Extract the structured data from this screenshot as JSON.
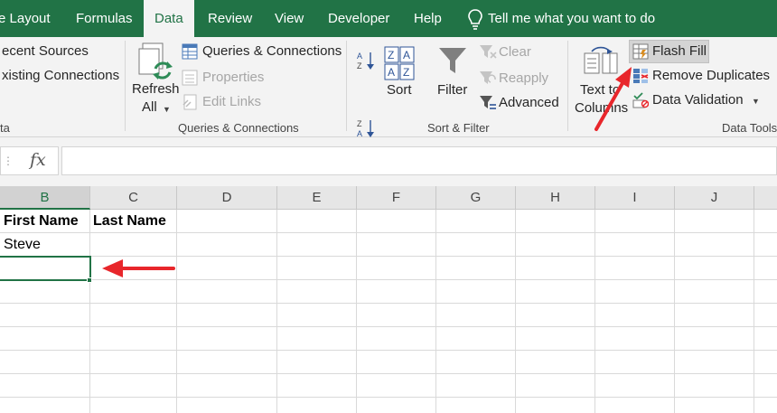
{
  "tabs": [
    {
      "label": "e Layout",
      "active": false
    },
    {
      "label": "Formulas",
      "active": false
    },
    {
      "label": "Data",
      "active": true
    },
    {
      "label": "Review",
      "active": false
    },
    {
      "label": "View",
      "active": false
    },
    {
      "label": "Developer",
      "active": false
    },
    {
      "label": "Help",
      "active": false
    }
  ],
  "tell_me": "Tell me what you want to do",
  "ribbon": {
    "get_data": {
      "recent_sources": "ecent Sources",
      "existing_connections": "xisting Connections",
      "group_label": "ta"
    },
    "queries": {
      "refresh_line1": "Refresh",
      "refresh_line2": "All",
      "queries_connections": "Queries & Connections",
      "properties": "Properties",
      "edit_links": "Edit Links",
      "group_label": "Queries & Connections"
    },
    "sort_filter": {
      "sort": "Sort",
      "filter": "Filter",
      "clear": "Clear",
      "reapply": "Reapply",
      "advanced": "Advanced",
      "group_label": "Sort & Filter"
    },
    "data_tools": {
      "text_to_line1": "Text to",
      "text_to_line2": "Columns",
      "flash_fill": "Flash Fill",
      "remove_duplicates": "Remove Duplicates",
      "data_validation": "Data Validation",
      "group_label": "Data Tools"
    }
  },
  "formula_bar": {
    "fx_label": "fx",
    "value": ""
  },
  "grid": {
    "columns": [
      "B",
      "C",
      "D",
      "E",
      "F",
      "G",
      "H",
      "I",
      "J"
    ],
    "selected_column": "B",
    "cells": {
      "b1": "First Name",
      "c1": "Last Name",
      "b2": "Steve"
    }
  },
  "colors": {
    "accent_green": "#217346",
    "annotation_red": "#e8262b"
  }
}
